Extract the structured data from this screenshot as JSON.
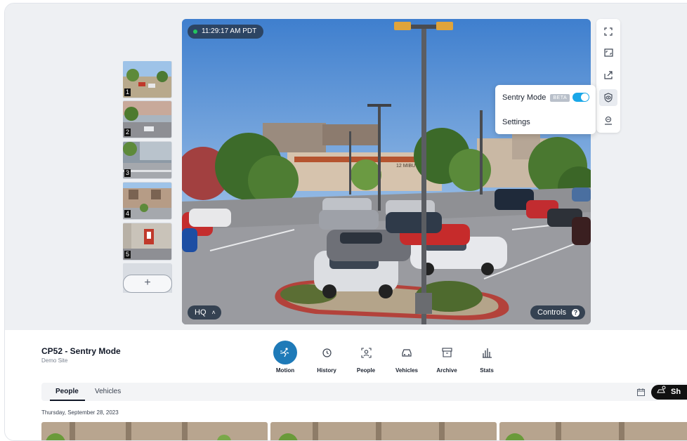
{
  "camera": {
    "timestamp": "11:29:17 AM PDT",
    "quality": "HQ",
    "controls_label": "Controls",
    "help_glyph": "?",
    "building_sign": "12 MIBU"
  },
  "thumbnails": [
    {
      "number": "1"
    },
    {
      "number": "2"
    },
    {
      "number": "3"
    },
    {
      "number": "4"
    },
    {
      "number": "5"
    }
  ],
  "add_label": "+",
  "toolbar": {
    "icons": [
      "expand-icon",
      "fit-icon",
      "share-icon",
      "sentry-eye-icon",
      "face-scan-icon"
    ]
  },
  "popover": {
    "sentry_label": "Sentry Mode",
    "beta": "BETA",
    "sentry_enabled": true,
    "settings_label": "Settings"
  },
  "site": {
    "title": "CP52 - Sentry Mode",
    "subtitle": "Demo Site"
  },
  "nav": [
    {
      "label": "Motion",
      "icon": "motion-icon",
      "active": true
    },
    {
      "label": "History",
      "icon": "history-icon",
      "active": false
    },
    {
      "label": "People",
      "icon": "people-icon",
      "active": false
    },
    {
      "label": "Vehicles",
      "icon": "vehicles-icon",
      "active": false
    },
    {
      "label": "Archive",
      "icon": "archive-icon",
      "active": false
    },
    {
      "label": "Stats",
      "icon": "stats-icon",
      "active": false
    }
  ],
  "tabs": [
    {
      "label": "People",
      "active": true
    },
    {
      "label": "Vehicles",
      "active": false
    }
  ],
  "show_button": "Sh",
  "date_heading": "Thursday, September 28, 2023",
  "colors": {
    "accent": "#1e7ab8",
    "toggle": "#1aa7e8",
    "live": "#22c55e"
  }
}
